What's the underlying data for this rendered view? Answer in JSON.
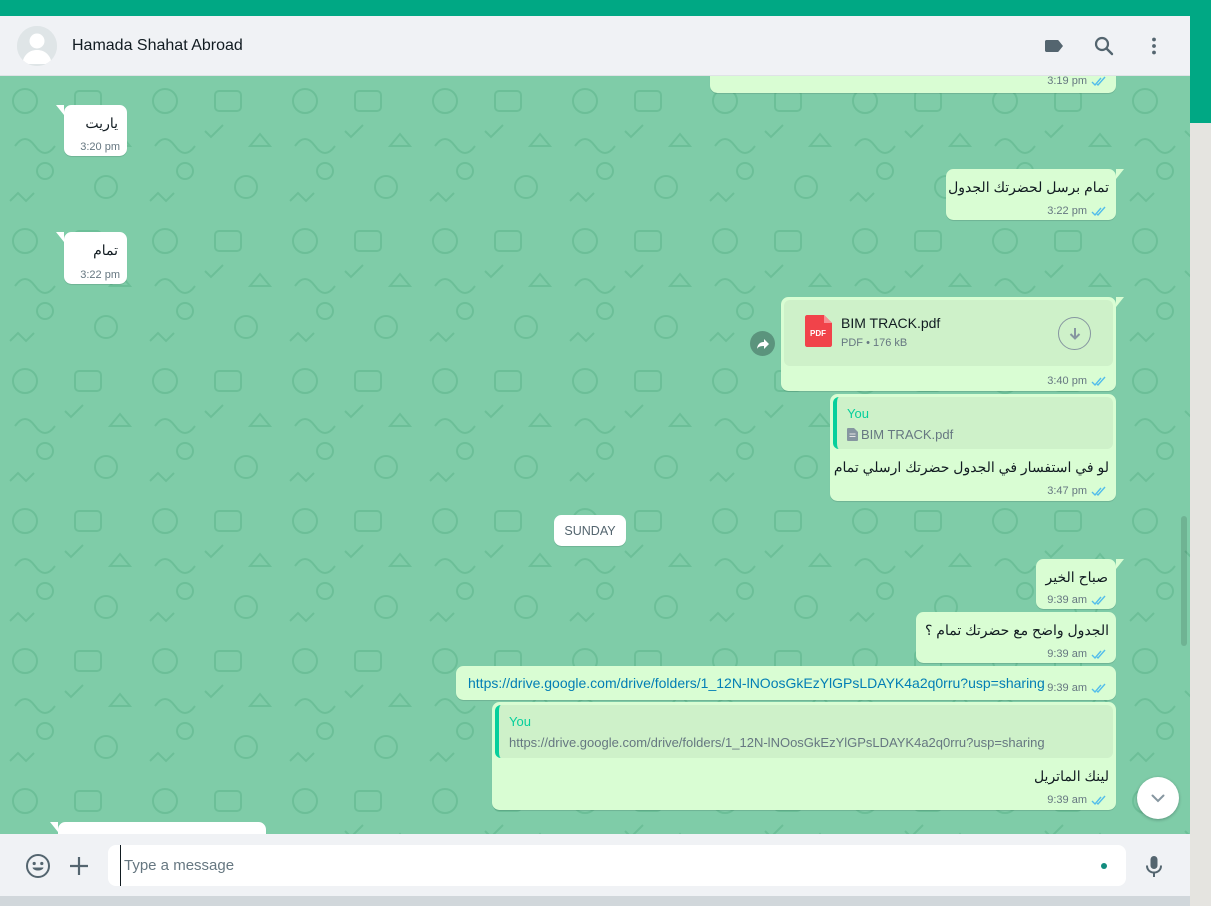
{
  "header": {
    "contact_name": "Hamada Shahat Abroad"
  },
  "colors": {
    "accent": "#00a884",
    "chat_background": "#7fcca8",
    "incoming_bubble": "#ffffff",
    "outgoing_bubble": "#d9fdd3",
    "read_ticks": "#53bdeb",
    "link": "#027eb5"
  },
  "icons": {
    "avatar": "default-user-icon",
    "labels": "label-icon",
    "search": "search-icon",
    "menu": "kebab-menu-icon",
    "forward": "forward-icon",
    "download": "download-icon",
    "pdf": "pdf-file-icon",
    "doc": "document-icon",
    "scroll_down": "chevron-down-icon",
    "emoji": "emoji-icon",
    "attach": "plus-icon",
    "mic": "microphone-icon"
  },
  "messages": [
    {
      "id": "m0",
      "direction": "out",
      "text": "",
      "time": "3:19 pm",
      "status": "read"
    },
    {
      "id": "m1",
      "direction": "in",
      "text": "ياريت",
      "time": "3:20 pm"
    },
    {
      "id": "m2",
      "direction": "out",
      "text": "تمام برسل لحضرتك الجدول",
      "time": "3:22 pm",
      "status": "read"
    },
    {
      "id": "m3",
      "direction": "in",
      "text": "تمام",
      "time": "3:22 pm"
    },
    {
      "id": "m4",
      "direction": "out",
      "type": "document",
      "file_name": "BIM TRACK.pdf",
      "file_type": "PDF",
      "file_size": "176 kB",
      "time": "3:40 pm",
      "status": "read"
    },
    {
      "id": "m5",
      "direction": "out",
      "reply_to": {
        "author": "You",
        "text": "BIM TRACK.pdf"
      },
      "text": "لو في استفسار في الجدول حضرتك ارسلي تمام",
      "time": "3:47 pm",
      "status": "read"
    },
    {
      "id": "m6",
      "direction": "out",
      "text": "صباح الخير",
      "time": "9:39 am",
      "status": "read"
    },
    {
      "id": "m7",
      "direction": "out",
      "text": "الجدول واضح مع حضرتك تمام ؟",
      "time": "9:39 am",
      "status": "read"
    },
    {
      "id": "m8",
      "direction": "out",
      "text": "https://drive.google.com/drive/folders/1_12N-lNOosGkEzYlGPsLDAYK4a2q0rru?usp=sharing",
      "time": "9:39 am",
      "status": "read"
    },
    {
      "id": "m9",
      "direction": "out",
      "reply_to": {
        "author": "You",
        "text": "https://drive.google.com/drive/folders/1_12N-lNOosGkEzYlGPsLDAYK4a2q0rru?usp=sharing"
      },
      "text": "لينك الماتريل",
      "time": "9:39 am",
      "status": "read"
    },
    {
      "id": "m10",
      "direction": "in",
      "text": "",
      "time": ""
    }
  ],
  "date_separator": "SUNDAY",
  "composer": {
    "placeholder": "Type a message"
  }
}
